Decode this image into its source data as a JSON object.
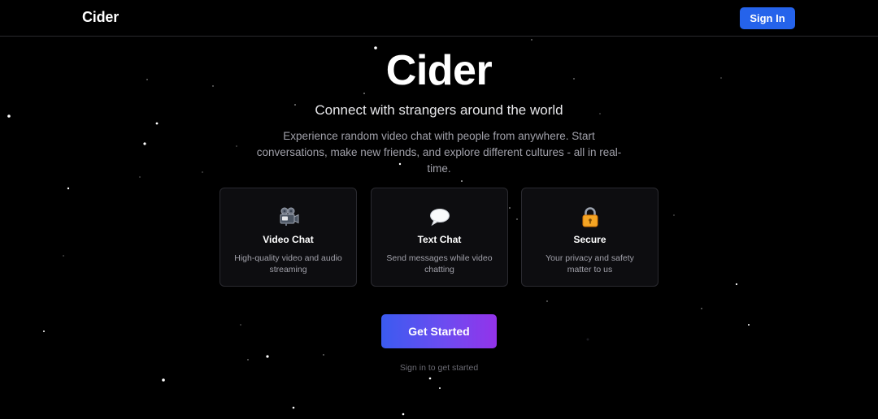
{
  "navbar": {
    "brand": "Cider",
    "signin_label": "Sign In"
  },
  "hero": {
    "title": "Cider",
    "subtitle": "Connect with strangers around the world",
    "description": "Experience random video chat with people from anywhere. Start conversations, make new friends, and explore different cultures - all in real-time."
  },
  "features": [
    {
      "icon": "video-camera-icon",
      "title": "Video Chat",
      "description": "High-quality video and audio streaming"
    },
    {
      "icon": "speech-bubble-icon",
      "title": "Text Chat",
      "description": "Send messages while video chatting"
    },
    {
      "icon": "lock-icon",
      "title": "Secure",
      "description": "Your privacy and safety matter to us"
    }
  ],
  "cta": {
    "label": "Get Started",
    "hint": "Sign in to get started"
  },
  "colors": {
    "background": "#000000",
    "accent": "#2563eb",
    "gradient_start": "#3b5bf0",
    "gradient_end": "#9333ea"
  }
}
